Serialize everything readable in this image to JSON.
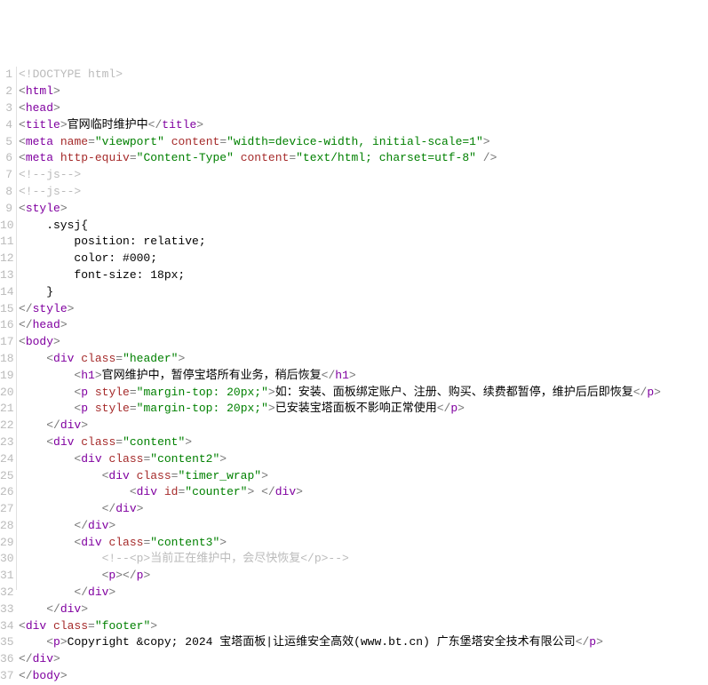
{
  "gutter": {
    "start": 1,
    "end": 37
  },
  "lines": {
    "l1": {
      "raw": "<!DOCTYPE html>"
    },
    "l2": {
      "tag": "html",
      "open": true
    },
    "l3": {
      "tag": "head",
      "open": true
    },
    "l4": {
      "tag": "title",
      "text": "官网临时维护中",
      "close": "title"
    },
    "l5": {
      "tag": "meta",
      "attrs": [
        [
          "name",
          "viewport"
        ],
        [
          "content",
          "width=device-width, initial-scale=1"
        ]
      ],
      "selfclose": false
    },
    "l6": {
      "tag": "meta",
      "attrs": [
        [
          "http-equiv",
          "Content-Type"
        ],
        [
          "content",
          "text/html; charset=utf-8"
        ]
      ],
      "selfclose": true
    },
    "l7": {
      "comment": "js"
    },
    "l8": {
      "comment": "js"
    },
    "l9": {
      "tag": "style",
      "open": true
    },
    "l10": {
      "css": "    .sysj{"
    },
    "l11": {
      "css": "        position: relative;"
    },
    "l12": {
      "css": "        color: #000;"
    },
    "l13": {
      "css": "        font-size: 18px;"
    },
    "l14": {
      "css": "    }"
    },
    "l15": {
      "closetag": "style"
    },
    "l16": {
      "closetag": "head"
    },
    "l17": {
      "tag": "body",
      "open": true
    },
    "l18": {
      "indent": 1,
      "tag": "div",
      "attrs": [
        [
          "class",
          "header"
        ]
      ],
      "open": true
    },
    "l19": {
      "indent": 2,
      "tag": "h1",
      "text": "官网维护中，暂停宝塔所有业务，稍后恢复",
      "close": "h1"
    },
    "l20": {
      "indent": 2,
      "tag": "p",
      "attrs": [
        [
          "style",
          "margin-top: 20px;"
        ]
      ],
      "text": "如：安装、面板绑定账户、注册、购买、续费都暂停，维护后后即恢复",
      "close": "p"
    },
    "l21": {
      "indent": 2,
      "tag": "p",
      "attrs": [
        [
          "style",
          "margin-top: 20px;"
        ]
      ],
      "text": "已安装宝塔面板不影响正常使用",
      "close": "p"
    },
    "l22": {
      "indent": 1,
      "closetag": "div"
    },
    "l23": {
      "indent": 1,
      "tag": "div",
      "attrs": [
        [
          "class",
          "content"
        ]
      ],
      "open": true
    },
    "l24": {
      "indent": 2,
      "tag": "div",
      "attrs": [
        [
          "class",
          "content2"
        ]
      ],
      "open": true
    },
    "l25": {
      "indent": 3,
      "tag": "div",
      "attrs": [
        [
          "class",
          "timer_wrap"
        ]
      ],
      "open": true
    },
    "l26": {
      "indent": 4,
      "tag": "div",
      "attrs": [
        [
          "id",
          "counter"
        ]
      ],
      "text": " ",
      "close": "div"
    },
    "l27": {
      "indent": 3,
      "closetag": "div"
    },
    "l28": {
      "indent": 2,
      "closetag": "div"
    },
    "l29": {
      "indent": 2,
      "tag": "div",
      "attrs": [
        [
          "class",
          "content3"
        ]
      ],
      "open": true
    },
    "l30": {
      "indent": 3,
      "rawcomment": "<!--<p>当前正在维护中，会尽快恢复</p>-->"
    },
    "l31": {
      "indent": 3,
      "tag": "p",
      "close": "p"
    },
    "l32": {
      "indent": 2,
      "closetag": "div"
    },
    "l33": {
      "indent": 1,
      "closetag": "div"
    },
    "l34": {
      "tag": "div",
      "attrs": [
        [
          "class",
          "footer"
        ]
      ],
      "open": true
    },
    "l35": {
      "indent": 1,
      "tag": "p",
      "text": "Copyright &copy; 2024 宝塔面板|让运维安全高效(www.bt.cn) 广东堡塔安全技术有限公司",
      "close": "p"
    },
    "l36": {
      "closetag": "div"
    },
    "l37": {
      "closetag": "body"
    }
  }
}
